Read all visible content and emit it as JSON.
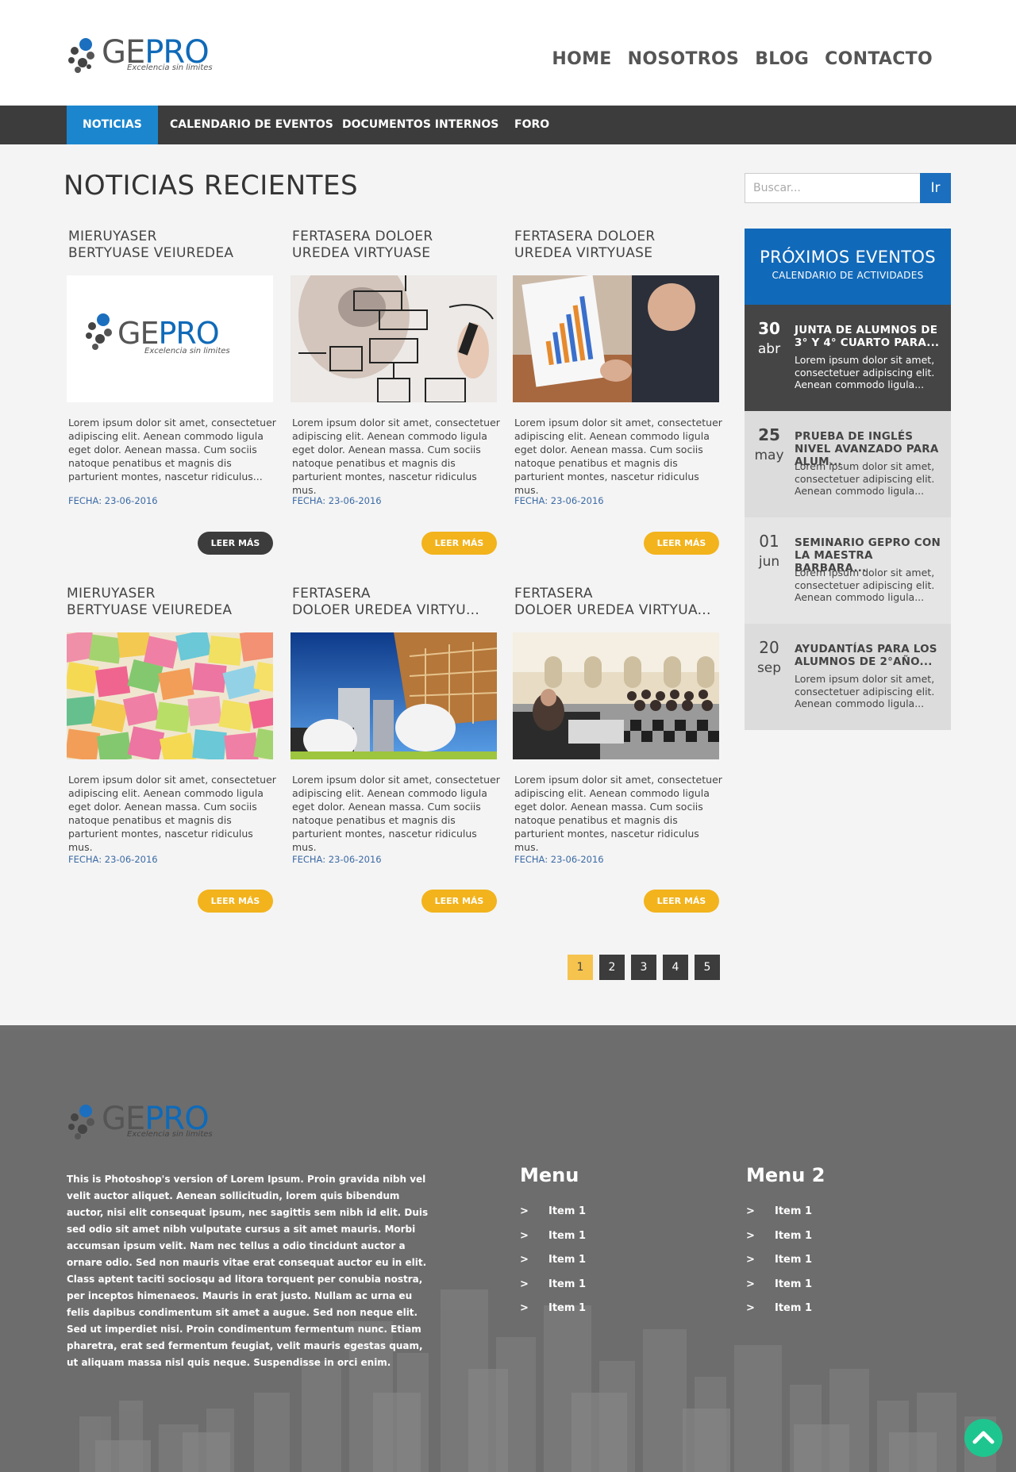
{
  "brand": {
    "name_part1": "GE",
    "name_part2": "PRO",
    "tagline": "Excelencia sin limites"
  },
  "topnav": [
    {
      "label": "HOME"
    },
    {
      "label": "NOSOTROS"
    },
    {
      "label": "BLOG"
    },
    {
      "label": "CONTACTO"
    }
  ],
  "subnav": [
    {
      "label": "NOTICIAS",
      "active": true
    },
    {
      "label": "CALENDARIO DE EVENTOS"
    },
    {
      "label": "DOCUMENTOS INTERNOS"
    },
    {
      "label": "FORO"
    }
  ],
  "main": {
    "title": "NOTICIAS RECIENTES"
  },
  "cards": [
    {
      "title_line1": "MIERUYASER",
      "title_line2": "BERTYUASE VEIUREDEA",
      "text": "Lorem ipsum dolor sit amet, consectetuer adipiscing elit. Aenean commodo ligula eget dolor. Aenean massa. Cum sociis natoque penatibus et magnis dis parturient montes, nascetur ridiculus...",
      "date": "FECHA: 23-06-2016",
      "button": "LEER MÁS",
      "image": "gepro-logo"
    },
    {
      "title_line1": "FERTASERA DOLOER",
      "title_line2": "UREDEA VIRTYUASE",
      "text": "Lorem ipsum dolor sit amet, consectetuer adipiscing elit. Aenean commodo ligula eget dolor. Aenean massa. Cum sociis natoque penatibus et magnis dis parturient montes, nascetur ridiculus mus.",
      "date": "FECHA: 23-06-2016",
      "button": "LEER MÁS",
      "image": "flowchart"
    },
    {
      "title_line1": "FERTASERA DOLOER",
      "title_line2": "UREDEA VIRTYUASE",
      "text": "Lorem ipsum dolor sit amet, consectetuer adipiscing elit. Aenean commodo ligula eget dolor. Aenean massa. Cum sociis natoque penatibus et magnis dis parturient montes, nascetur ridiculus mus.",
      "date": "FECHA: 23-06-2016",
      "button": "LEER MÁS",
      "image": "business-chart"
    },
    {
      "title_line1": "MIERUYASER",
      "title_line2": "BERTYUASE VEIUREDEA",
      "text": "Lorem ipsum dolor sit amet, consectetuer adipiscing elit. Aenean commodo ligula eget dolor. Aenean massa. Cum sociis natoque penatibus et magnis dis parturient montes, nascetur ridiculus mus.",
      "date": "FECHA: 23-06-2016",
      "button": "LEER MÁS",
      "image": "sticky-notes"
    },
    {
      "title_line1": "FERTASERA",
      "title_line2": "DOLOER UREDEA VIRTYU...",
      "text": "Lorem ipsum dolor sit amet, consectetuer adipiscing elit. Aenean commodo ligula eget dolor. Aenean massa. Cum sociis natoque penatibus et magnis dis parturient montes, nascetur ridiculus mus.",
      "date": "FECHA: 23-06-2016",
      "button": "LEER MÁS",
      "image": "construction"
    },
    {
      "title_line1": "FERTASERA",
      "title_line2": "DOLOER UREDEA VIRTYUA...",
      "text": "Lorem ipsum dolor sit amet, consectetuer adipiscing elit. Aenean commodo ligula eget dolor. Aenean massa. Cum sociis natoque penatibus et magnis dis parturient montes, nascetur ridiculus mus.",
      "date": "FECHA: 23-06-2016",
      "button": "LEER MÁS",
      "image": "conference-hall"
    }
  ],
  "pagination": [
    "1",
    "2",
    "3",
    "4",
    "5"
  ],
  "search": {
    "placeholder": "Buscar...",
    "button": "Ir"
  },
  "events": {
    "title": "PRÓXIMOS EVENTOS",
    "subtitle": "CALENDARIO DE ACTIVIDADES",
    "items": [
      {
        "day": "30",
        "month": "abr",
        "title": "JUNTA DE ALUMNOS DE 3° Y 4° CUARTO PARA...",
        "text": "Lorem ipsum dolor sit amet, consectetuer adipiscing elit. Aenean commodo ligula..."
      },
      {
        "day": "25",
        "month": "may",
        "title": "PRUEBA DE INGLÉS NIVEL AVANZADO PARA ALUM...",
        "text": "Lorem ipsum dolor sit amet, consectetuer adipiscing elit. Aenean commodo ligula..."
      },
      {
        "day": "01",
        "month": "jun",
        "title": "SEMINARIO GEPRO CON LA MAESTRA BARBARA...",
        "text": "Lorem ipsum dolor sit amet, consectetuer adipiscing elit. Aenean commodo ligula..."
      },
      {
        "day": "20",
        "month": "sep",
        "title": "AYUDANTÍAS PARA LOS ALUMNOS DE 2°AÑO...",
        "text": "Lorem ipsum dolor sit amet, consectetuer adipiscing elit. Aenean commodo ligula..."
      }
    ]
  },
  "footer": {
    "text": "This is Photoshop's version  of Lorem Ipsum. Proin gravida nibh vel velit auctor aliquet. Aenean sollicitudin, lorem quis bibendum auctor, nisi elit consequat ipsum, nec sagittis sem nibh id elit. Duis sed odio sit amet nibh vulputate cursus a sit amet mauris. Morbi accumsan ipsum velit. Nam nec tellus a odio tincidunt auctor a ornare odio. Sed non  mauris vitae erat consequat auctor eu in elit. Class aptent taciti sociosqu ad litora torquent per conubia nostra, per inceptos himenaeos. Mauris in erat justo. Nullam ac urna eu felis dapibus condimentum sit amet a augue. Sed non neque elit. Sed ut imperdiet nisi. Proin condimentum fermentum nunc. Etiam pharetra, erat sed fermentum feugiat, velit mauris egestas quam, ut aliquam massa nisl quis neque. Suspendisse in orci enim.",
    "menu1": {
      "title": "Menu",
      "arrow": ">",
      "items": [
        "Item 1",
        "Item 1",
        "Item 1",
        "Item 1",
        "Item 1"
      ]
    },
    "menu2": {
      "title": "Menu 2",
      "arrow": ">",
      "items": [
        "Item 1",
        "Item 1",
        "Item 1",
        "Item 1",
        "Item 1"
      ]
    }
  },
  "colors": {
    "accent_blue": "#1b86ce",
    "button_yellow": "#f2b31c",
    "dark": "#3c3c3c",
    "scroll_top": "#1fc58e"
  },
  "icons": {
    "scroll_top": "chevron-up-icon"
  }
}
